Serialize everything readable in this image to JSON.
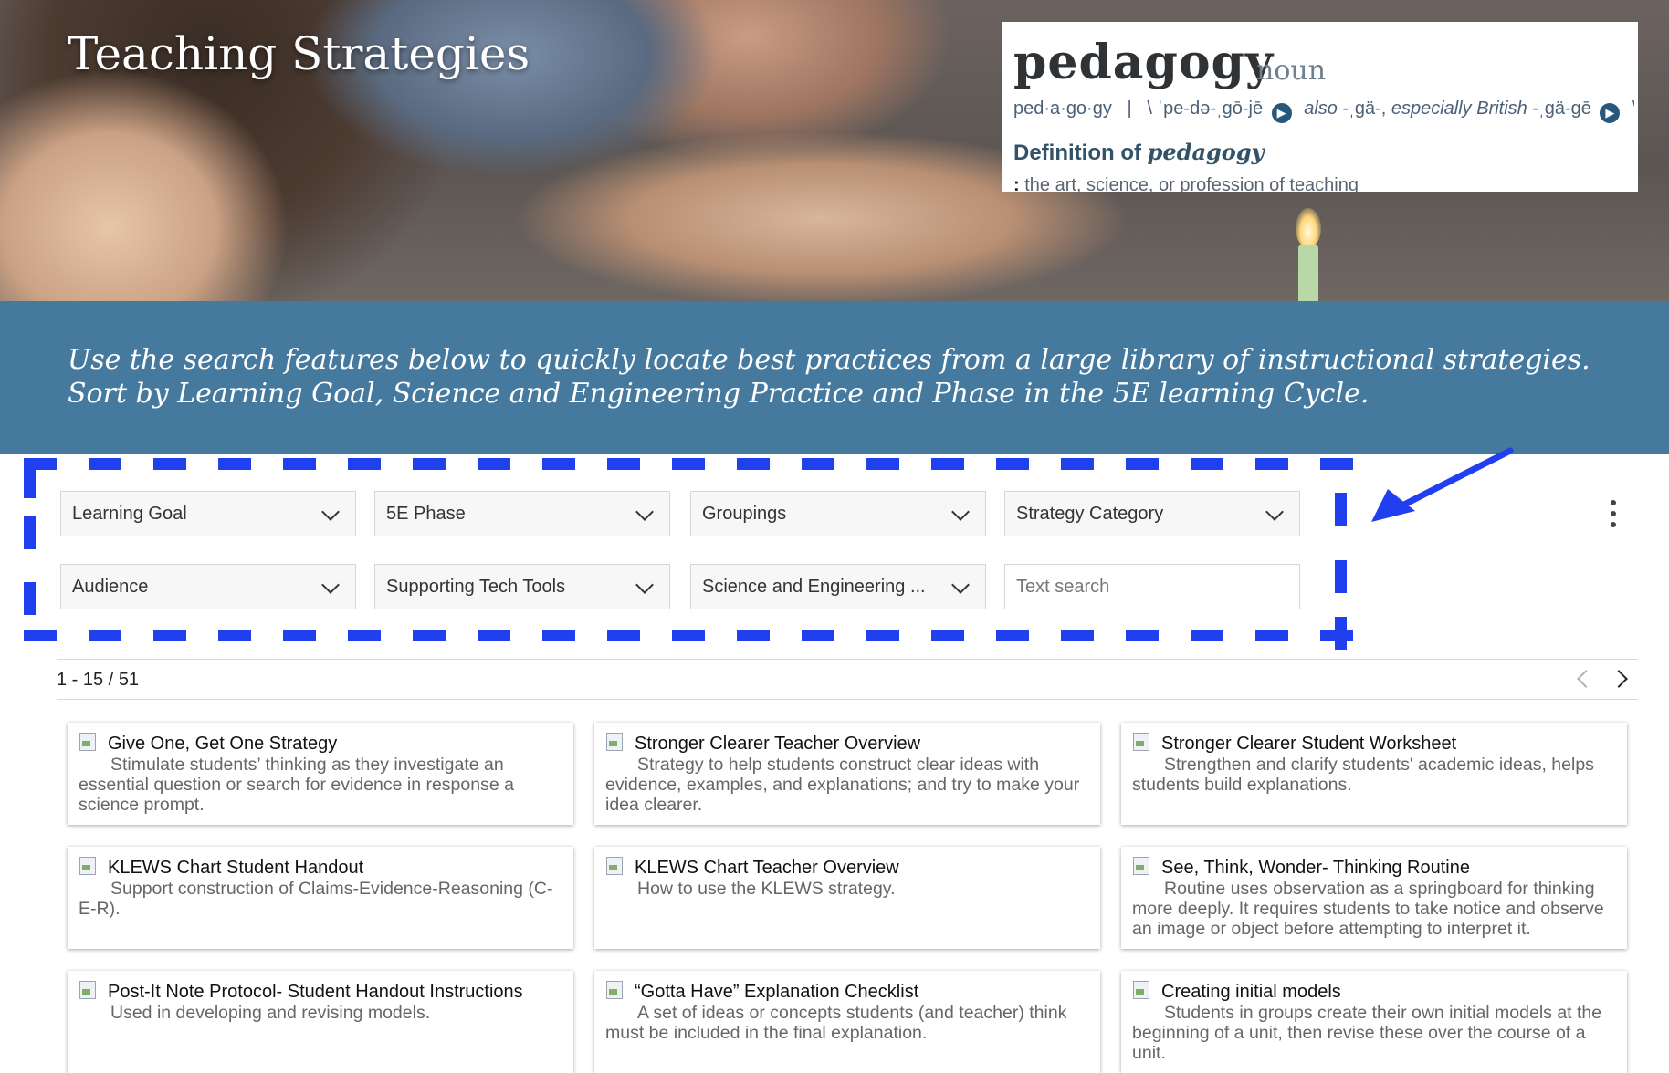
{
  "hero": {
    "title": "Teaching Strategies",
    "dictionary": {
      "word": "pedagogy",
      "part_of_speech": "noun",
      "syllables": "ped·a·go·gy",
      "separator": "|",
      "pronunciation": "\\ ˈpe-də-ˌgō-jē",
      "also_label": "also",
      "alt_pronunciation_1": "-ˌgä-,",
      "especially_label": "especially British",
      "alt_pronunciation_2": "-ˌgä-gē",
      "trailing": "\\",
      "definition_heading": "Definition of",
      "definition_word": "pedagogy",
      "definition_colon": ":",
      "definition_text": "the art, science, or profession of teaching"
    }
  },
  "banner": {
    "text": "Use the search features below to quickly locate best practices from a large library of  instructional strategies.  Sort by Learning Goal, Science and Engineering Practice and Phase in the 5E learning Cycle."
  },
  "filters": {
    "learning_goal": "Learning Goal",
    "phase": "5E Phase",
    "groupings": "Groupings",
    "strategy_category": "Strategy Category",
    "audience": "Audience",
    "tech_tools": "Supporting Tech Tools",
    "sep": "Science and Engineering ...",
    "search_placeholder": "Text search"
  },
  "results": {
    "count": "1 - 15 / 51"
  },
  "cards": [
    {
      "title": "Give One, Get One Strategy",
      "desc_first": "Stimulate students’ thinking as they investigate an",
      "desc_rest": "essential question or search for evidence in response a science prompt."
    },
    {
      "title": "Stronger Clearer Teacher Overview",
      "desc_first": "Strategy to help students construct clear ideas with",
      "desc_rest": "evidence, examples, and explanations; and try to make your idea clearer."
    },
    {
      "title": "Stronger Clearer Student Worksheet",
      "desc_first": "Strengthen and clarify students' academic ideas, helps",
      "desc_rest": "students build explanations."
    },
    {
      "title": "KLEWS Chart Student Handout",
      "desc_first": "Support construction of Claims-Evidence-Reasoning (C-",
      "desc_rest": "E-R)."
    },
    {
      "title": "KLEWS Chart Teacher Overview",
      "desc_first": "How to use the KLEWS strategy.",
      "desc_rest": ""
    },
    {
      "title": "See, Think, Wonder- Thinking Routine",
      "desc_first": "Routine uses observation as a springboard for thinking",
      "desc_rest": "more deeply. It requires students to take notice and observe an image or object before attempting to interpret it."
    },
    {
      "title": "Post-It Note Protocol- Student Handout Instructions",
      "desc_first": "Used in developing and revising models.",
      "desc_rest": ""
    },
    {
      "title": "“Gotta Have” Explanation Checklist",
      "desc_first": "A set of ideas or concepts students (and teacher) think",
      "desc_rest": "must be included in the final explanation."
    },
    {
      "title": "Creating initial models",
      "desc_first": "Students in groups create their own initial models at the",
      "desc_rest": "beginning of a unit, then revise these over the course of a unit."
    }
  ],
  "colors": {
    "banner": "#457a9e",
    "annotation_dash": "#2040f0",
    "card_title": "#111111",
    "card_desc": "#666666"
  },
  "icons": {
    "dropdown": "chevron-down-icon",
    "more": "more-vert-icon",
    "prev": "chevron-left-icon",
    "next": "chevron-right-icon",
    "thumbnail": "broken-image-icon",
    "annotation": "arrow-annotation-icon",
    "audio": "speaker-icon"
  }
}
